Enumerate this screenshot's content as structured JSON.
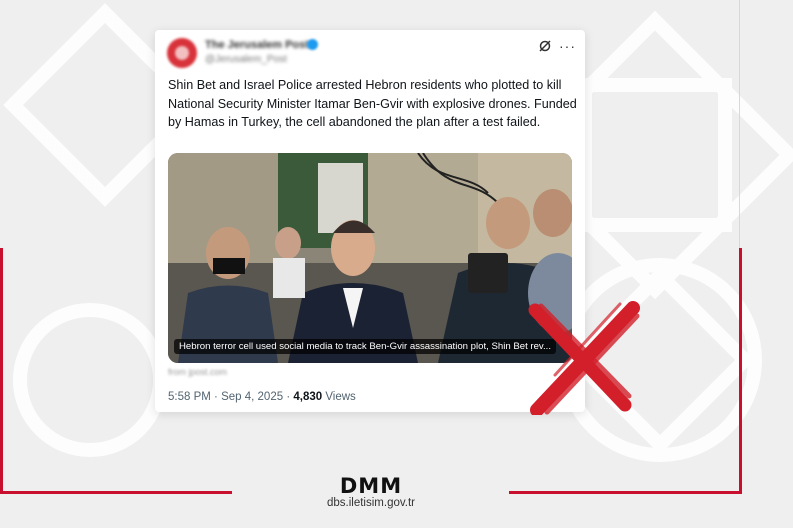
{
  "colors": {
    "accent": "#c8102e",
    "background": "#efefef",
    "link_blue": "#1d9bf0"
  },
  "post": {
    "account_name": "The Jerusalem Post",
    "account_handle": "@Jerusalem_Post",
    "text": "Shin Bet and Israel Police arrested Hebron residents who plotted to kill National Security Minister Itamar Ben-Gvir with explosive drones. Funded by Hamas in Turkey, the cell abandoned the plan after a test failed.",
    "media_caption": "Hebron terror cell used social media to track Ben-Gvir assassination plot, Shin Bet rev...",
    "link_source": "from jpost.com",
    "time": "5:58 PM",
    "separator": "·",
    "date": "Sep 4, 2025",
    "views_count": "4,830",
    "views_label": "Views",
    "icons": [
      "grok-icon",
      "more-options-icon"
    ]
  },
  "verdict": {
    "icon": "red-x-mark-icon"
  },
  "footer": {
    "logo": "DMM",
    "url": "dbs.iletisim.gov.tr"
  }
}
